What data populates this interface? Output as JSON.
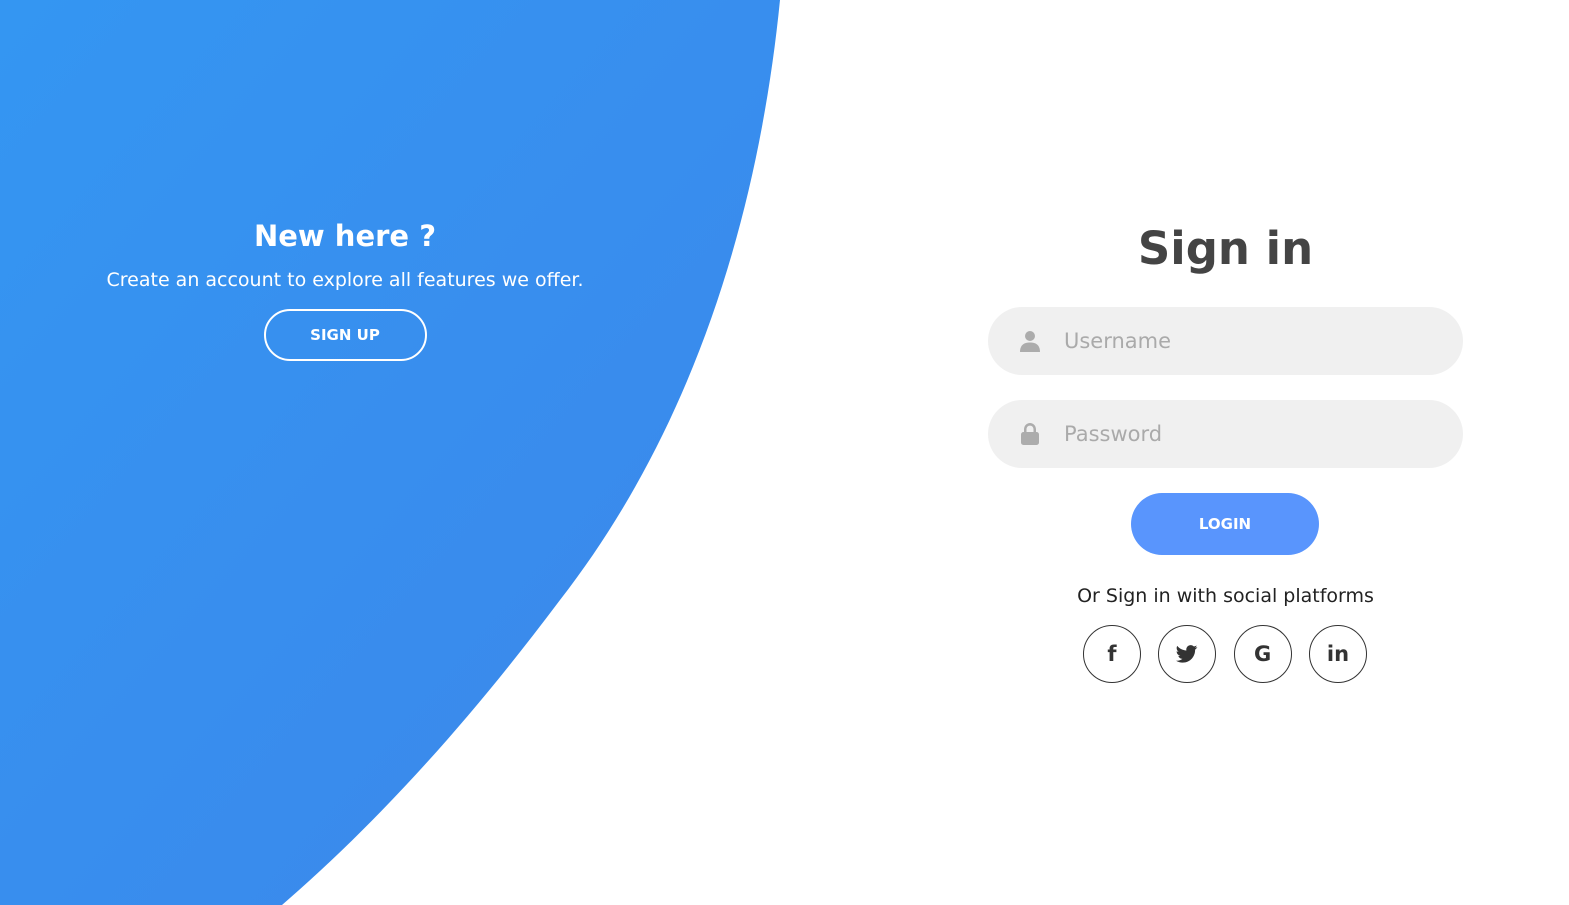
{
  "colors": {
    "accent": "#4481eb",
    "accent_light": "#04befe",
    "button": "#5995fd",
    "input_bg": "#f0f0f0",
    "title": "#444444"
  },
  "left_panel": {
    "title": "New here ?",
    "description": "Create an account to explore all features we offer.",
    "signup_label": "SIGN UP"
  },
  "signin": {
    "title": "Sign in",
    "username": {
      "placeholder": "Username",
      "value": "",
      "icon": "user-icon"
    },
    "password": {
      "placeholder": "Password",
      "value": "",
      "icon": "lock-icon"
    },
    "login_label": "LOGIN",
    "social_text": "Or Sign in with social platforms",
    "social": [
      {
        "icon": "facebook-icon",
        "glyph": "f"
      },
      {
        "icon": "twitter-icon",
        "glyph": ""
      },
      {
        "icon": "google-icon",
        "glyph": "G"
      },
      {
        "icon": "linkedin-icon",
        "glyph": "in"
      }
    ]
  }
}
